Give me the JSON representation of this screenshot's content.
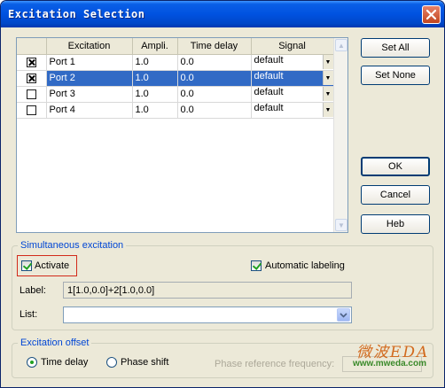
{
  "window": {
    "title": "Excitation Selection"
  },
  "grid": {
    "columns": [
      "",
      "Excitation",
      "Ampli.",
      "Time delay",
      "Signal"
    ],
    "rows": [
      {
        "checked": true,
        "excitation": "Port 1",
        "ampli": "1.0",
        "delay": "0.0",
        "signal": "default",
        "selected": false
      },
      {
        "checked": true,
        "excitation": "Port 2",
        "ampli": "1.0",
        "delay": "0.0",
        "signal": "default",
        "selected": true
      },
      {
        "checked": false,
        "excitation": "Port 3",
        "ampli": "1.0",
        "delay": "0.0",
        "signal": "default",
        "selected": false
      },
      {
        "checked": false,
        "excitation": "Port 4",
        "ampli": "1.0",
        "delay": "0.0",
        "signal": "default",
        "selected": false
      }
    ]
  },
  "buttons": {
    "set_all": "Set All",
    "set_none": "Set None",
    "ok": "OK",
    "cancel": "Cancel",
    "help": "Heb"
  },
  "simultaneous": {
    "title": "Simultaneous excitation",
    "activate_label": "Activate",
    "activate_checked": true,
    "auto_label": "Automatic labeling",
    "auto_checked": true,
    "label_caption": "Label:",
    "label_value": "1[1.0,0.0]+2[1.0,0.0]",
    "list_caption": "List:",
    "list_value": ""
  },
  "offset": {
    "title": "Excitation offset",
    "time_delay_label": "Time delay",
    "phase_shift_label": "Phase shift",
    "selected": "time_delay",
    "phase_ref_label": "Phase reference frequency:"
  },
  "watermark": {
    "brand": "微波EDA",
    "url": "www.mweda.com"
  },
  "colors": {
    "title_bar": "#0052e0",
    "selection": "#316ac5",
    "group_title": "#0046d5",
    "highlight_box": "#d22a1a"
  }
}
